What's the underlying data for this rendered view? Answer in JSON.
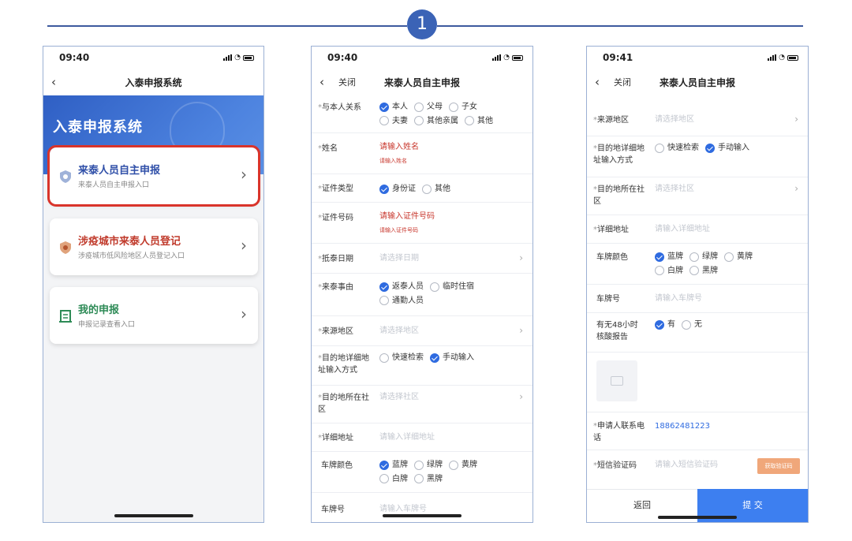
{
  "step": "1",
  "colors": {
    "accent": "#2f6be0",
    "highlight": "#d9342b",
    "brand_blue": "#3b63b6",
    "sms_button": "#f0a77a"
  },
  "phone1": {
    "time": "09:40",
    "nav_title": "入泰申报系统",
    "hero_title": "入泰申报系统",
    "cards": [
      {
        "title": "来泰人员自主申报",
        "subtitle": "来泰人员自主申报入口",
        "title_color": "#2f4fa8",
        "icon": "shield-icon",
        "highlighted": true
      },
      {
        "title": "涉疫城市来泰人员登记",
        "subtitle": "涉疫城市低风险地区人员登记入口",
        "title_color": "#c03a2b",
        "icon": "badge-icon",
        "highlighted": false
      },
      {
        "title": "我的申报",
        "subtitle": "申报记录查看入口",
        "title_color": "#2e8b57",
        "icon": "document-icon",
        "highlighted": false
      }
    ]
  },
  "phone2": {
    "time": "09:40",
    "close_label": "关闭",
    "nav_title": "来泰人员自主申报",
    "relation": {
      "label": "与本人关系",
      "options": [
        "本人",
        "父母",
        "子女",
        "夫妻",
        "其他亲属",
        "其他"
      ],
      "selected": "本人"
    },
    "name": {
      "label": "姓名",
      "placeholder": "请输入姓名",
      "hint": "请输入姓名"
    },
    "id_type": {
      "label": "证件类型",
      "options": [
        "身份证",
        "其他"
      ],
      "selected": "身份证"
    },
    "id_number": {
      "label": "证件号码",
      "placeholder": "请输入证件号码",
      "hint": "请输入证件号码"
    },
    "arrival_date": {
      "label": "抵泰日期",
      "placeholder": "请选择日期"
    },
    "reason": {
      "label": "来泰事由",
      "options": [
        "返泰人员",
        "临时住宿",
        "通勤人员"
      ],
      "selected": "返泰人员"
    },
    "origin": {
      "label": "来源地区",
      "placeholder": "请选择地区"
    },
    "addr_mode": {
      "label": "目的地详细地址输入方式",
      "options": [
        "快速检索",
        "手动输入"
      ],
      "selected": "手动输入"
    },
    "community": {
      "label": "目的地所在社区",
      "placeholder": "请选择社区"
    },
    "address": {
      "label": "详细地址",
      "placeholder": "请输入详细地址"
    },
    "plate_color": {
      "label": "车牌颜色",
      "options": [
        "蓝牌",
        "绿牌",
        "黄牌",
        "白牌",
        "黑牌"
      ],
      "selected": "蓝牌"
    },
    "plate_no": {
      "label": "车牌号",
      "placeholder": "请输入车牌号"
    }
  },
  "phone3": {
    "time": "09:41",
    "close_label": "关闭",
    "nav_title": "来泰人员自主申报",
    "origin": {
      "label": "来源地区",
      "placeholder": "请选择地区"
    },
    "addr_mode": {
      "label": "目的地详细地址输入方式",
      "options": [
        "快速检索",
        "手动输入"
      ],
      "selected": "手动输入"
    },
    "community": {
      "label": "目的地所在社区",
      "placeholder": "请选择社区"
    },
    "address": {
      "label": "详细地址",
      "placeholder": "请输入详细地址"
    },
    "plate_color": {
      "label": "车牌颜色",
      "options": [
        "蓝牌",
        "绿牌",
        "黄牌",
        "白牌",
        "黑牌"
      ],
      "selected": "蓝牌"
    },
    "plate_no": {
      "label": "车牌号",
      "placeholder": "请输入车牌号"
    },
    "nat_report": {
      "label": "有无48小时核酸报告",
      "options": [
        "有",
        "无"
      ],
      "selected": "有"
    },
    "phone": {
      "label": "申请人联系电话",
      "value": "18862481223"
    },
    "sms": {
      "label": "短信验证码",
      "placeholder": "请输入短信验证码",
      "button": "获取验证码"
    },
    "back_label": "返回",
    "submit_label": "提 交"
  }
}
